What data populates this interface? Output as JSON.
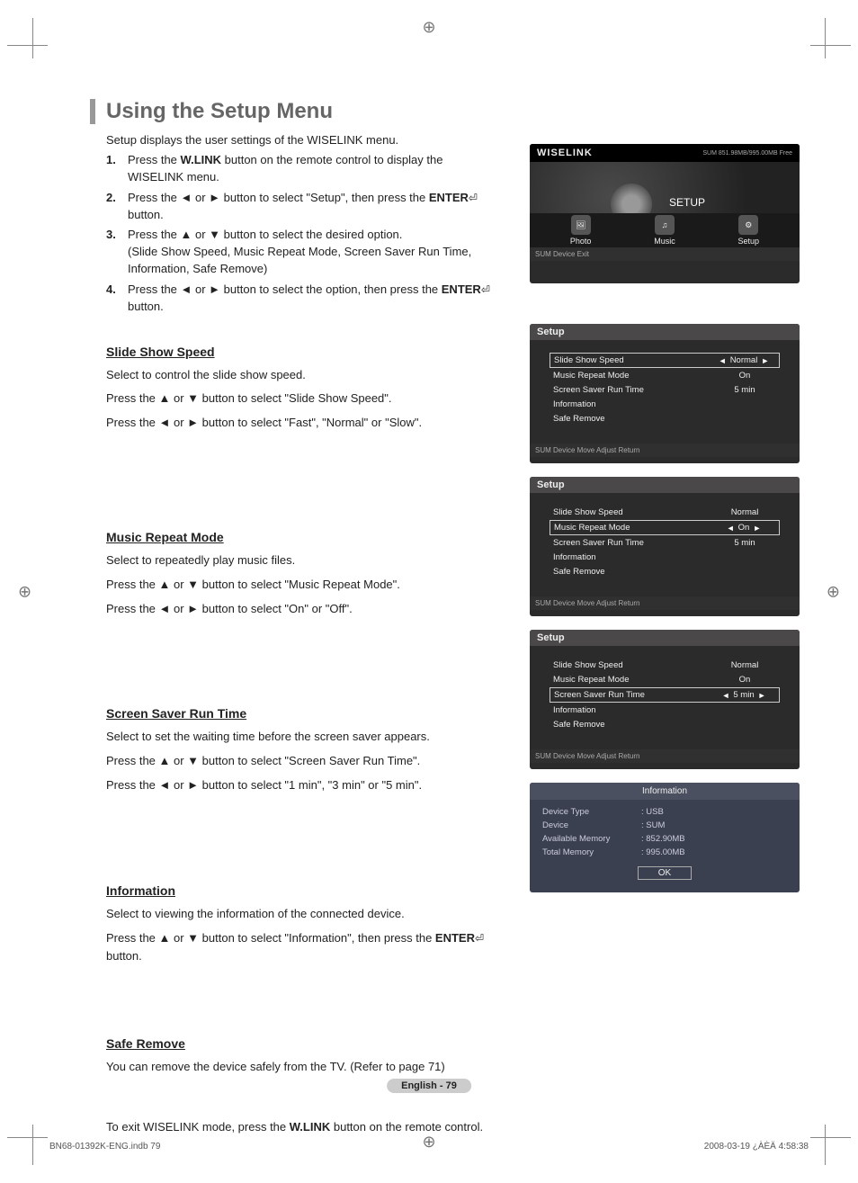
{
  "title": "Using the Setup Menu",
  "intro": "Setup displays the user settings of the WISELINK menu.",
  "steps": [
    {
      "num": "1.",
      "body_pre": "Press the ",
      "bold": "W.LINK",
      "body_post": " button on the remote control to display the WISELINK menu."
    },
    {
      "num": "2.",
      "body_pre": "Press the ◄ or ► button to select \"Setup\", then press the ",
      "bold": "ENTER",
      "body_post": " button.",
      "enter_icon": true
    },
    {
      "num": "3.",
      "body_pre": "Press the ▲ or ▼ button to select the desired option.",
      "bold": "",
      "body_post": "",
      "sub": "(Slide Show Speed, Music Repeat Mode, Screen Saver Run Time, Information, Safe Remove)"
    },
    {
      "num": "4.",
      "body_pre": "Press the ◄ or ► button to select the option, then press the ",
      "bold": "ENTER",
      "body_post": " button.",
      "enter_icon": true
    }
  ],
  "sections": {
    "slide": {
      "heading": "Slide Show Speed",
      "lines": [
        "Select to control the slide show speed.",
        "Press the ▲ or ▼ button to select \"Slide Show Speed\".",
        "Press the ◄ or ► button to select \"Fast\", \"Normal\" or \"Slow\"."
      ]
    },
    "music": {
      "heading": "Music Repeat Mode",
      "lines": [
        "Select to repeatedly play music files.",
        "Press the ▲ or ▼ button to select \"Music Repeat Mode\".",
        "Press the ◄ or ► button to select \"On\" or \"Off\"."
      ]
    },
    "saver": {
      "heading": "Screen Saver Run Time",
      "lines": [
        "Select to set the waiting time before the screen saver appears.",
        "Press the ▲ or ▼ button to select \"Screen Saver Run Time\".",
        "Press the ◄ or ► button to select \"1 min\", \"3 min\" or \"5 min\"."
      ]
    },
    "info": {
      "heading": "Information",
      "lines": [
        "Select to viewing the information of the connected device."
      ],
      "line_enter_pre": "Press the ▲ or ▼ button to select \"Information\", then press the ",
      "line_enter_bold": "ENTER",
      "line_enter_post": " button."
    },
    "safe": {
      "heading": "Safe Remove",
      "lines": [
        "You can remove the device safely from the TV. (Refer to page 71)"
      ]
    }
  },
  "exit_line_pre": "To exit WISELINK mode, press the ",
  "exit_line_bold": "W.LINK",
  "exit_line_post": " button on the remote control.",
  "page_foot_lang": "English - 79",
  "page_foot_left": "BN68-01392K-ENG.indb   79",
  "page_foot_right": "2008-03-19   ¿ÀÈÄ 4:58:38",
  "wiselink_ss": {
    "brand": "WISELINK",
    "sum_label": "SUM",
    "mem_free": "851.98MB/995.00MB Free",
    "setup_label": "SETUP",
    "icons": {
      "photo": "Photo",
      "music": "Music",
      "setup": "Setup"
    },
    "hints": "SUM      Device    Exit"
  },
  "setup_menu": {
    "title": "Setup",
    "rows": [
      {
        "label": "Slide Show Speed",
        "value": "Normal"
      },
      {
        "label": "Music Repeat Mode",
        "value": "On"
      },
      {
        "label": "Screen Saver Run Time",
        "value": "5 min"
      },
      {
        "label": "Information",
        "value": ""
      },
      {
        "label": "Safe Remove",
        "value": ""
      }
    ],
    "hints": "SUM      Device  Move  Adjust  Return"
  },
  "info_panel": {
    "title": "Information",
    "rows": [
      {
        "l": "Device Type",
        "v": ": USB"
      },
      {
        "l": "Device",
        "v": ": SUM"
      },
      {
        "l": "Available Memory",
        "v": ": 852.90MB"
      },
      {
        "l": "Total Memory",
        "v": ": 995.00MB"
      }
    ],
    "ok": "OK"
  }
}
